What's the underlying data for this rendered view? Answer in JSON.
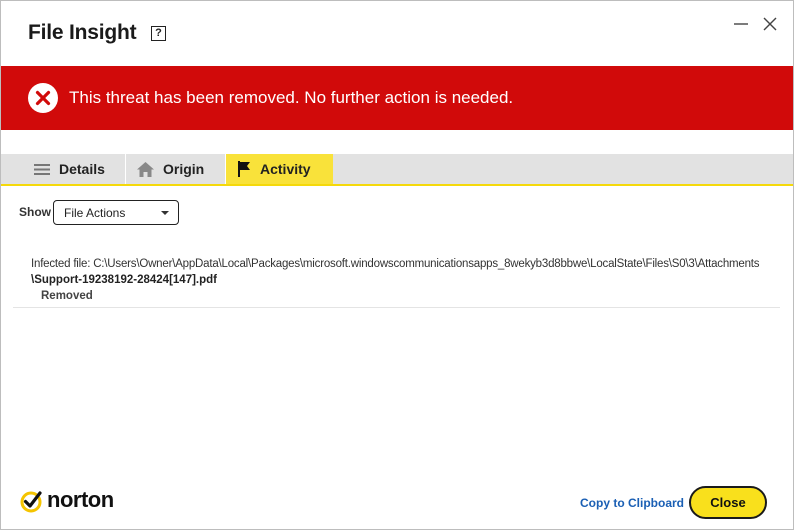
{
  "window": {
    "title": "File Insight",
    "help_glyph": "?"
  },
  "banner": {
    "message": "This threat has been removed. No further action is needed.",
    "color": "#d10a0a",
    "icon": "error-x-icon"
  },
  "tabs": [
    {
      "label": "Details",
      "icon": "list-icon",
      "selected": false
    },
    {
      "label": "Origin",
      "icon": "home-icon",
      "selected": false
    },
    {
      "label": "Activity",
      "icon": "flag-icon",
      "selected": true
    }
  ],
  "filter": {
    "label": "Show",
    "selected": "File Actions"
  },
  "activity": {
    "path_line": "Infected file: C:\\Users\\Owner\\AppData\\Local\\Packages\\microsoft.windowscommunicationsapps_8wekyb3d8bbwe\\LocalState\\Files\\S0\\3\\Attachments",
    "file_line": "\\Support-19238192-28424[147].pdf",
    "status": "Removed"
  },
  "footer": {
    "logo_text": "norton",
    "copy_label": "Copy to Clipboard",
    "close_label": "Close",
    "accent": "#f9e01c"
  }
}
